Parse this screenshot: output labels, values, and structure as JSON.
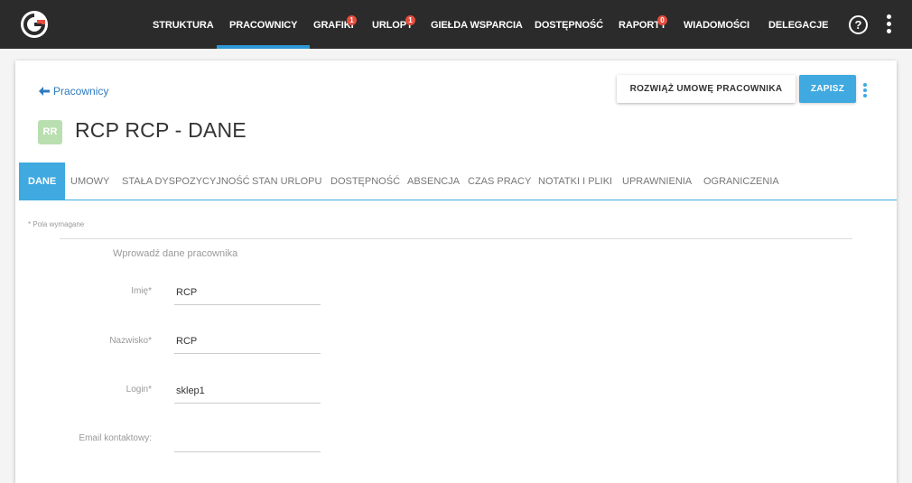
{
  "topbar": {
    "nav": [
      {
        "label": "STRUKTURA",
        "badge": null
      },
      {
        "label": "PRACOWNICY",
        "badge": null,
        "active": true
      },
      {
        "label": "GRAFIKI",
        "badge": "1"
      },
      {
        "label": "URLOPY",
        "badge": "1"
      },
      {
        "label": "GIEŁDA WSPARCIA",
        "badge": null
      },
      {
        "label": "DOSTĘPNOŚĆ",
        "badge": null
      },
      {
        "label": "RAPORTY",
        "badge": "0"
      },
      {
        "label": "WIADOMOŚCI",
        "badge": null
      },
      {
        "label": "DELEGACJE",
        "badge": null
      }
    ],
    "help_glyph": "?"
  },
  "header": {
    "back_label": "Pracownicy",
    "terminate_label": "ROZWIĄŻ UMOWĘ PRACOWNIKA",
    "save_label": "ZAPISZ",
    "avatar_initials": "RR",
    "title": "RCP RCP - DANE"
  },
  "tabs": [
    {
      "label": "DANE",
      "active": true
    },
    {
      "label": "UMOWY"
    },
    {
      "label": "STAŁA DYSPOZYCYJNOŚĆ"
    },
    {
      "label": "STAN URLOPU"
    },
    {
      "label": "DOSTĘPNOŚĆ"
    },
    {
      "label": "ABSENCJA"
    },
    {
      "label": "CZAS PRACY"
    },
    {
      "label": "NOTATKI I PLIKI"
    },
    {
      "label": "UPRAWNIENIA"
    },
    {
      "label": "OGRANICZENIA"
    }
  ],
  "form": {
    "required_note": "* Pola wymagane",
    "section_title": "Wprowadź dane pracownika",
    "fields": [
      {
        "label": "Imię*",
        "value": "RCP"
      },
      {
        "label": "Nazwisko*",
        "value": "RCP"
      },
      {
        "label": "Login*",
        "value": "sklep1"
      },
      {
        "label": "Email kontaktowy:",
        "value": ""
      }
    ]
  },
  "colors": {
    "topbar_bg": "#2b2b2b",
    "accent": "#3fa9e0",
    "badge": "#e74c3c",
    "avatar_bg": "#b9dfb0",
    "link": "#2e7bbf"
  }
}
